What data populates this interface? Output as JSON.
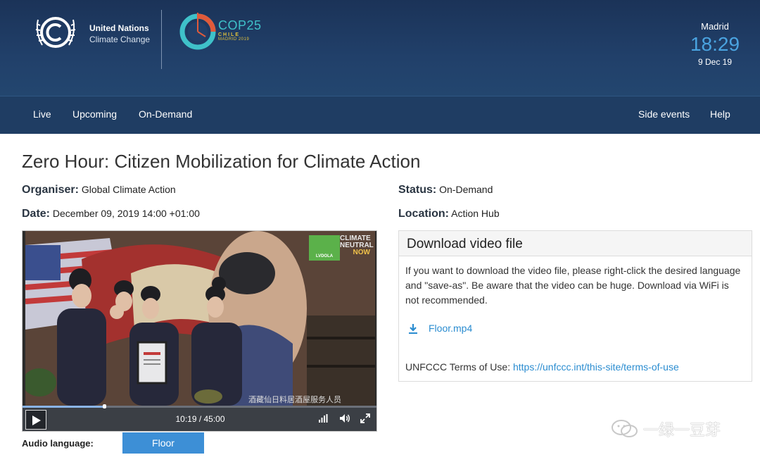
{
  "header": {
    "un_line1": "United Nations",
    "un_line2": "Climate Change",
    "cop_title": "COP25",
    "cop_sub1": "CHILE",
    "cop_sub2": "MADRID 2019",
    "clock_city": "Madrid",
    "clock_time": "18:29",
    "clock_date": "9 Dec 19",
    "accent_color": "#4aa3e0"
  },
  "nav": {
    "left": [
      "Live",
      "Upcoming",
      "On-Demand"
    ],
    "right": [
      "Side events",
      "Help"
    ]
  },
  "event": {
    "title": "Zero Hour: Citizen Mobilization for Climate Action",
    "organiser_key": "Organiser:",
    "organiser_val": "Global Climate Action",
    "date_key": "Date:",
    "date_val": "December 09, 2019 14:00 +01:00",
    "status_key": "Status:",
    "status_val": "On-Demand",
    "location_key": "Location:",
    "location_val": "Action Hub"
  },
  "video": {
    "current_time": "10:19 / 45:00",
    "progress": 0.229,
    "overlay_badge_line1": "CLIMATE",
    "overlay_badge_line2": "NEUTRAL",
    "overlay_badge_line3": "NOW",
    "overlay_logo": "LVDOLA",
    "caption": "酒藏仙日料居酒屋服务人员"
  },
  "audio": {
    "label": "Audio language:",
    "selected": "Floor"
  },
  "download": {
    "heading": "Download video file",
    "text": "If you want to download the video file, please right-click the desired language and \"save-as\". Be aware that the video can be huge. Download via WiFi is not recommended.",
    "file": "Floor.mp4",
    "terms_label": "UNFCCC Terms of Use:",
    "terms_link": "https://unfccc.int/this-site/terms-of-use"
  },
  "watermark": {
    "text": "一绿一豆芽"
  }
}
